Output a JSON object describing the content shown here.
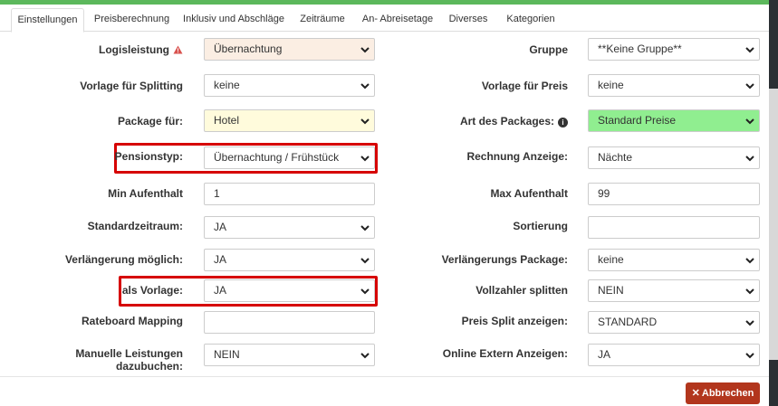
{
  "tabs": [
    {
      "label": "Einstellungen",
      "active": true
    },
    {
      "label": "Preisberechnung"
    },
    {
      "label": "Inklusiv und Abschläge"
    },
    {
      "label": "Zeiträume"
    },
    {
      "label": "An- Abreisetage"
    },
    {
      "label": "Diverses"
    },
    {
      "label": "Kategorien"
    }
  ],
  "left": {
    "logisleistung": {
      "label": "Logisleistung",
      "value": "Übernachtung"
    },
    "vorlage_splitting": {
      "label": "Vorlage für Splitting",
      "value": "keine"
    },
    "package_fuer": {
      "label": "Package für:",
      "value": "Hotel"
    },
    "pensionstyp": {
      "label": "Pensionstyp:",
      "value": "Übernachtung / Frühstück"
    },
    "min_aufenthalt": {
      "label": "Min Aufenthalt",
      "value": "1"
    },
    "standardzeitraum": {
      "label": "Standardzeitraum:",
      "value": "JA"
    },
    "verlaengerung": {
      "label": "Verlängerung möglich:",
      "value": "JA"
    },
    "als_vorlage": {
      "label": "als Vorlage:",
      "value": "JA"
    },
    "rateboard": {
      "label": "Rateboard Mapping",
      "value": ""
    },
    "manuelle": {
      "label": "Manuelle Leistungen dazubuchen:",
      "value": "NEIN"
    }
  },
  "right": {
    "gruppe": {
      "label": "Gruppe",
      "value": "**Keine Gruppe**"
    },
    "vorlage_preis": {
      "label": "Vorlage für Preis",
      "value": "keine"
    },
    "art_packages": {
      "label": "Art des Packages:",
      "value": "Standard Preise"
    },
    "rechnung_anzeige": {
      "label": "Rechnung Anzeige:",
      "value": "Nächte"
    },
    "max_aufenthalt": {
      "label": "Max Aufenthalt",
      "value": "99"
    },
    "sortierung": {
      "label": "Sortierung",
      "value": ""
    },
    "verlaengerungs_package": {
      "label": "Verlängerungs Package:",
      "value": "keine"
    },
    "vollzahler": {
      "label": "Vollzahler splitten",
      "value": "NEIN"
    },
    "preis_split": {
      "label": "Preis Split anzeigen:",
      "value": "STANDARD"
    },
    "online_extern": {
      "label": "Online Extern Anzeigen:",
      "value": "JA"
    }
  },
  "footer": {
    "cancel_label": "Abbrechen"
  },
  "colors": {
    "accent_bar": "#5cb85c",
    "highlight": "#d60000",
    "cancel": "#b2361d",
    "green_select": "#90ee90"
  },
  "icons": {
    "warning": "warning-icon",
    "info": "info-icon",
    "close": "close-icon",
    "chevron": "chevron-down-icon"
  }
}
